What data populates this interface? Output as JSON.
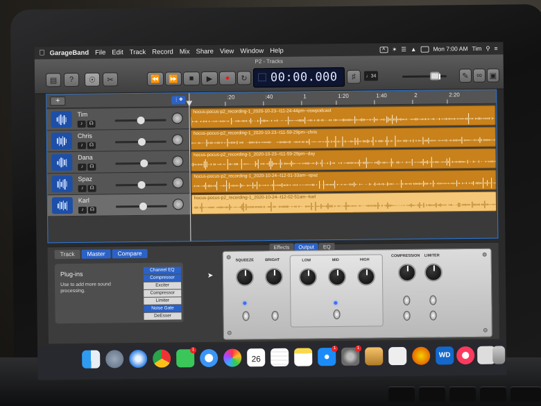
{
  "menubar": {
    "app_name": "GarageBand",
    "items": [
      "File",
      "Edit",
      "Track",
      "Record",
      "Mix",
      "Share",
      "View",
      "Window",
      "Help"
    ],
    "clock": "Mon 7:00 AM",
    "user": "Tim"
  },
  "window": {
    "title": "P2 - Tracks"
  },
  "transport": {
    "time": "00:00.000",
    "count_in": "♩34"
  },
  "tracks_header": {
    "add_label": "+",
    "ruler_ticks": [
      ":20",
      ":40",
      "1",
      "1:20",
      "1:40",
      "2",
      "2:20"
    ]
  },
  "tracks": [
    {
      "name": "Tim",
      "volume": 0.5,
      "region": "hocus-pocus-p2_recording-1_2020-10-23--t11-24-44pm--oswpodcast"
    },
    {
      "name": "Chris",
      "volume": 0.52,
      "region": "hocus-pocus-p2_recording-1_2020-10-23--t11-59-29pm--chris"
    },
    {
      "name": "Dana",
      "volume": 0.55,
      "region": "hocus-pocus-p2_recording-1_2020-10-23--t11-59-29pm--day"
    },
    {
      "name": "Spaz",
      "volume": 0.5,
      "region": "hocus-pocus-p2_recording-1_2020-10-24--t12-01-33am--spaz"
    },
    {
      "name": "Karl",
      "volume": 0.53,
      "region": "hocus-pocus-p2_recording-1_2020-10-24--t12-02-51am--karl"
    }
  ],
  "smart_controls": {
    "tabs": [
      "Track",
      "Master",
      "Compare"
    ],
    "view_tabs": [
      "Effects",
      "Output",
      "EQ"
    ],
    "plugins_title": "Plug-ins",
    "plugins_desc": "Use to add more sound processing.",
    "plugins": [
      "Channel EQ",
      "Compressor",
      "Exciter",
      "Compressor",
      "Limiter",
      "Noise Gate",
      "DeEsser"
    ],
    "knob_labels": [
      "SQUEEZE",
      "BRIGHT",
      "LOW",
      "MID",
      "HIGH",
      "COMPRESSION",
      "LIMITER"
    ]
  },
  "dock": {
    "badges": {
      "facetime": "1",
      "appstore": "1",
      "sysprefs": "1"
    },
    "calendar_day": "26",
    "wd_label": "WD"
  },
  "colors": {
    "region": "#c8811b",
    "region_selected": "#f4c878",
    "accent": "#2b62c7",
    "lcd": "#0d1530"
  },
  "icons": {
    "library": "library-icon",
    "help": "help-icon",
    "smart_controls": "smart-controls-icon",
    "editors": "scissors-icon",
    "rewind": "rewind-icon",
    "forward": "fast-forward-icon",
    "stop": "stop-icon",
    "play": "play-icon",
    "record": "record-icon",
    "cycle": "cycle-icon"
  }
}
